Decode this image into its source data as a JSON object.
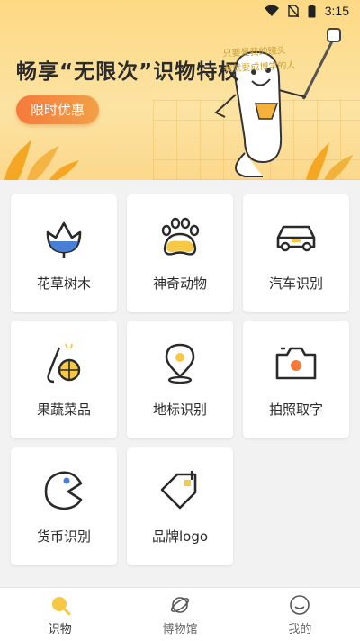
{
  "status_bar": {
    "time": "3:15"
  },
  "banner": {
    "title": "畅享“无限次”识物特权",
    "button_label": "限时优惠",
    "note_line1": "只要是我的镜头",
    "note_line2": "我就要成博学的人"
  },
  "grid": {
    "items": [
      {
        "label": "花草树木",
        "icon": "flower-icon"
      },
      {
        "label": "神奇动物",
        "icon": "paw-icon"
      },
      {
        "label": "汽车识别",
        "icon": "car-icon"
      },
      {
        "label": "果蔬菜品",
        "icon": "fruit-icon"
      },
      {
        "label": "地标识别",
        "icon": "location-pin-icon"
      },
      {
        "label": "拍照取字",
        "icon": "camera-icon"
      },
      {
        "label": "货币识别",
        "icon": "coin-icon"
      },
      {
        "label": "品牌logo",
        "icon": "tag-icon"
      }
    ]
  },
  "bottom_nav": {
    "items": [
      {
        "label": "识物",
        "icon": "search-icon",
        "active": true
      },
      {
        "label": "博物馆",
        "icon": "planet-icon",
        "active": false
      },
      {
        "label": "我的",
        "icon": "smile-icon",
        "active": false
      }
    ]
  },
  "colors": {
    "accent_yellow": "#f7c844",
    "accent_orange": "#f57a3c",
    "accent_blue": "#4a7fd8"
  }
}
